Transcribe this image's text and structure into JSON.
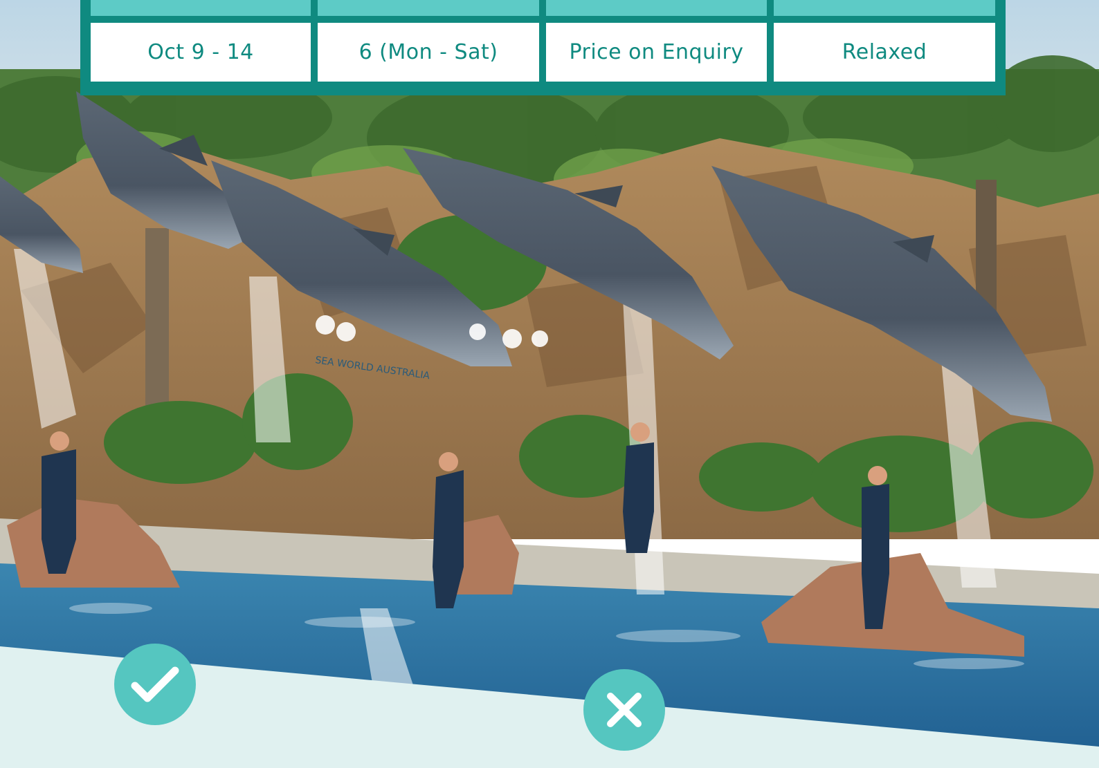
{
  "table": {
    "columns": [
      {
        "value": "Oct 9 - 14"
      },
      {
        "value": "6 (Mon - Sat)"
      },
      {
        "value": "Price on Enquiry"
      },
      {
        "value": "Relaxed"
      }
    ]
  },
  "photo": {
    "sign_text": "SEA WORLD AUSTRALIA"
  },
  "badges": {
    "check_icon": "check-icon",
    "cross_icon": "cross-icon"
  },
  "colors": {
    "accent_dark": "#0f8a80",
    "accent_light": "#5dcbc6",
    "badge": "#55c6c0",
    "footer_band": "#e0f1f0"
  }
}
